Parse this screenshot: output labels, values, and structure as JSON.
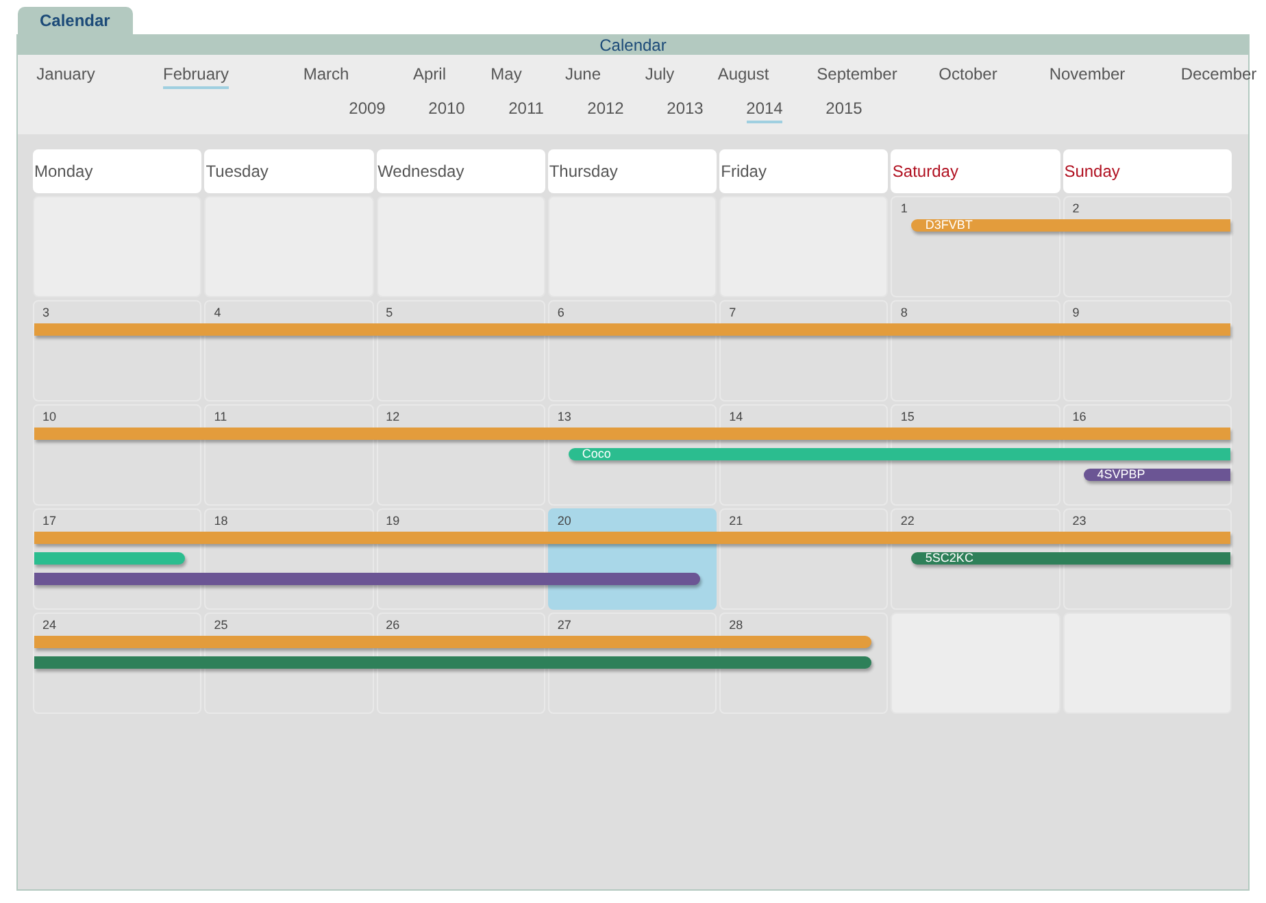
{
  "tab": {
    "label": "Calendar",
    "selected": true
  },
  "title": "Calendar",
  "months": [
    {
      "label": "January",
      "selected": false
    },
    {
      "label": "February",
      "selected": true
    },
    {
      "label": "March",
      "selected": false
    },
    {
      "label": "April",
      "selected": false
    },
    {
      "label": "May",
      "selected": false
    },
    {
      "label": "June",
      "selected": false
    },
    {
      "label": "July",
      "selected": false
    },
    {
      "label": "August",
      "selected": false
    },
    {
      "label": "September",
      "selected": false
    },
    {
      "label": "October",
      "selected": false
    },
    {
      "label": "November",
      "selected": false
    },
    {
      "label": "December",
      "selected": false
    }
  ],
  "years": [
    {
      "label": "2009",
      "selected": false
    },
    {
      "label": "2010",
      "selected": false
    },
    {
      "label": "2011",
      "selected": false
    },
    {
      "label": "2012",
      "selected": false
    },
    {
      "label": "2013",
      "selected": false
    },
    {
      "label": "2014",
      "selected": true
    },
    {
      "label": "2015",
      "selected": false
    }
  ],
  "weekdays": [
    {
      "label": "Monday",
      "weekend": false
    },
    {
      "label": "Tuesday",
      "weekend": false
    },
    {
      "label": "Wednesday",
      "weekend": false
    },
    {
      "label": "Thursday",
      "weekend": false
    },
    {
      "label": "Friday",
      "weekend": false
    },
    {
      "label": "Saturday",
      "weekend": true
    },
    {
      "label": "Sunday",
      "weekend": true
    }
  ],
  "weeks": [
    {
      "days": [
        {
          "in_month": false,
          "today": false
        },
        {
          "in_month": false,
          "today": false
        },
        {
          "in_month": false,
          "today": false
        },
        {
          "in_month": false,
          "today": false
        },
        {
          "in_month": false,
          "today": false
        },
        {
          "date": "1",
          "in_month": true,
          "today": false
        },
        {
          "date": "2",
          "in_month": true,
          "today": false
        }
      ],
      "lanes": [
        [
          {
            "kind": "empty"
          },
          {
            "kind": "empty"
          },
          {
            "kind": "empty"
          },
          {
            "kind": "empty"
          },
          {
            "kind": "empty"
          },
          {
            "kind": "bar",
            "label": "D3FVBT",
            "color": "#e39c3c",
            "starts_here": true,
            "ends_here": false
          },
          {
            "kind": "continue"
          }
        ]
      ]
    },
    {
      "days": [
        {
          "date": "3",
          "in_month": true,
          "today": false
        },
        {
          "date": "4",
          "in_month": true,
          "today": false
        },
        {
          "date": "5",
          "in_month": true,
          "today": false
        },
        {
          "date": "6",
          "in_month": true,
          "today": false
        },
        {
          "date": "7",
          "in_month": true,
          "today": false
        },
        {
          "date": "8",
          "in_month": true,
          "today": false
        },
        {
          "date": "9",
          "in_month": true,
          "today": false
        }
      ],
      "lanes": [
        [
          {
            "kind": "bar",
            "color": "#e39c3c",
            "starts_here": false,
            "ends_here": false
          },
          {
            "kind": "continue"
          },
          {
            "kind": "continue"
          },
          {
            "kind": "continue"
          },
          {
            "kind": "continue"
          },
          {
            "kind": "continue"
          },
          {
            "kind": "continue"
          }
        ]
      ]
    },
    {
      "days": [
        {
          "date": "10",
          "in_month": true,
          "today": false
        },
        {
          "date": "11",
          "in_month": true,
          "today": false
        },
        {
          "date": "12",
          "in_month": true,
          "today": false
        },
        {
          "date": "13",
          "in_month": true,
          "today": false
        },
        {
          "date": "14",
          "in_month": true,
          "today": false
        },
        {
          "date": "15",
          "in_month": true,
          "today": false
        },
        {
          "date": "16",
          "in_month": true,
          "today": false
        }
      ],
      "lanes": [
        [
          {
            "kind": "bar",
            "color": "#e39c3c",
            "starts_here": false,
            "ends_here": false
          },
          {
            "kind": "continue"
          },
          {
            "kind": "continue"
          },
          {
            "kind": "continue"
          },
          {
            "kind": "continue"
          },
          {
            "kind": "continue"
          },
          {
            "kind": "continue"
          }
        ],
        [
          {
            "kind": "empty"
          },
          {
            "kind": "empty"
          },
          {
            "kind": "empty"
          },
          {
            "kind": "bar",
            "label": "Coco",
            "color": "#2bbd8f",
            "starts_here": true,
            "ends_here": false
          },
          {
            "kind": "continue"
          },
          {
            "kind": "continue"
          },
          {
            "kind": "continue"
          }
        ],
        [
          {
            "kind": "empty"
          },
          {
            "kind": "empty"
          },
          {
            "kind": "empty"
          },
          {
            "kind": "empty"
          },
          {
            "kind": "empty"
          },
          {
            "kind": "empty"
          },
          {
            "kind": "bar",
            "label": "4SVPBP",
            "color": "#6b5594",
            "starts_here": true,
            "ends_here": false
          }
        ]
      ]
    },
    {
      "days": [
        {
          "date": "17",
          "in_month": true,
          "today": false
        },
        {
          "date": "18",
          "in_month": true,
          "today": false
        },
        {
          "date": "19",
          "in_month": true,
          "today": false
        },
        {
          "date": "20",
          "in_month": true,
          "today": true
        },
        {
          "date": "21",
          "in_month": true,
          "today": false
        },
        {
          "date": "22",
          "in_month": true,
          "today": false
        },
        {
          "date": "23",
          "in_month": true,
          "today": false
        }
      ],
      "lanes": [
        [
          {
            "kind": "bar",
            "color": "#e39c3c",
            "starts_here": false,
            "ends_here": false
          },
          {
            "kind": "continue"
          },
          {
            "kind": "continue"
          },
          {
            "kind": "continue"
          },
          {
            "kind": "continue"
          },
          {
            "kind": "continue"
          },
          {
            "kind": "continue"
          }
        ],
        [
          {
            "kind": "bar",
            "color": "#2bbd8f",
            "starts_here": false,
            "ends_here": true
          },
          {
            "kind": "empty"
          },
          {
            "kind": "empty"
          },
          {
            "kind": "empty"
          },
          {
            "kind": "empty"
          },
          {
            "kind": "bar",
            "label": "5SC2KC",
            "color": "#2e8059",
            "starts_here": true,
            "ends_here": false
          },
          {
            "kind": "continue"
          }
        ],
        [
          {
            "kind": "bar",
            "color": "#6b5594",
            "starts_here": false,
            "ends_here": true
          },
          {
            "kind": "continue"
          },
          {
            "kind": "continue"
          },
          {
            "kind": "continue"
          },
          {
            "kind": "empty"
          },
          {
            "kind": "empty"
          },
          {
            "kind": "empty"
          }
        ]
      ]
    },
    {
      "days": [
        {
          "date": "24",
          "in_month": true,
          "today": false
        },
        {
          "date": "25",
          "in_month": true,
          "today": false
        },
        {
          "date": "26",
          "in_month": true,
          "today": false
        },
        {
          "date": "27",
          "in_month": true,
          "today": false
        },
        {
          "date": "28",
          "in_month": true,
          "today": false
        },
        {
          "in_month": false,
          "today": false
        },
        {
          "in_month": false,
          "today": false
        }
      ],
      "lanes": [
        [
          {
            "kind": "bar",
            "color": "#e39c3c",
            "starts_here": false,
            "ends_here": true
          },
          {
            "kind": "continue"
          },
          {
            "kind": "continue"
          },
          {
            "kind": "continue"
          },
          {
            "kind": "continue"
          },
          {
            "kind": "empty"
          },
          {
            "kind": "empty"
          }
        ],
        [
          {
            "kind": "bar",
            "color": "#2e8059",
            "starts_here": false,
            "ends_here": true
          },
          {
            "kind": "continue"
          },
          {
            "kind": "continue"
          },
          {
            "kind": "continue"
          },
          {
            "kind": "continue"
          },
          {
            "kind": "empty"
          },
          {
            "kind": "empty"
          }
        ]
      ]
    }
  ]
}
